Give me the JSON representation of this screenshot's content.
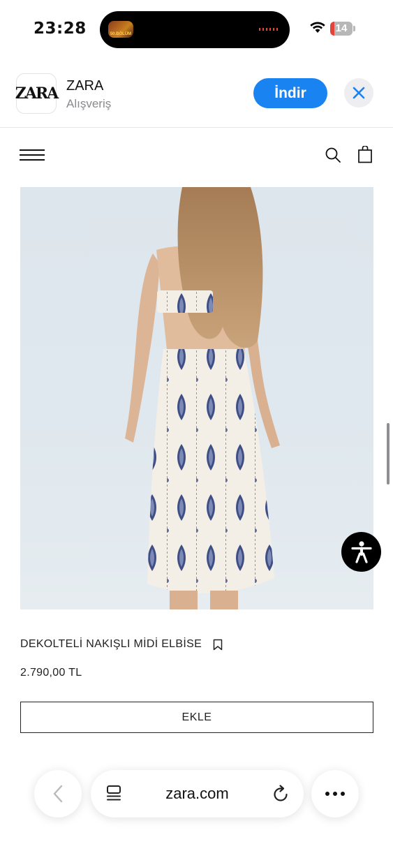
{
  "status_bar": {
    "time": "23:28",
    "island_badge": "50.BÖLÜM",
    "battery_level": "14"
  },
  "app_banner": {
    "icon_text": "ZARA",
    "app_name": "ZARA",
    "category": "Alışveriş",
    "get_label": "İndir",
    "accent_color": "#1a83f2"
  },
  "header": {
    "icons": [
      "menu-icon",
      "search-icon",
      "shopping-bag-icon"
    ]
  },
  "product": {
    "image": "back-view model in white midi dress with blue embroidery",
    "name": "DEKOLTELİ NAKIŞLI MİDİ ELBİSE",
    "price": "2.790,00 TL",
    "add_label": "EKLE"
  },
  "browser": {
    "url": "zara.com",
    "icons": [
      "back-chevron-icon",
      "reader-icon",
      "reload-icon",
      "more-icon"
    ]
  }
}
